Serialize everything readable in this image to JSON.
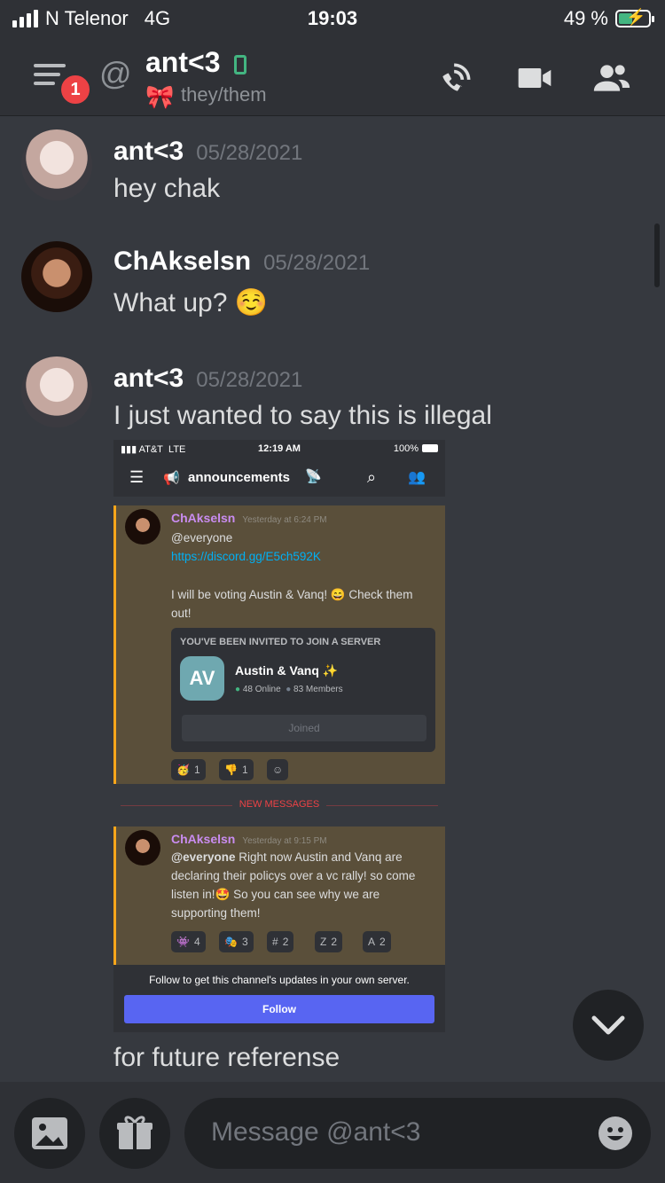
{
  "status_bar": {
    "carrier": "N Telenor",
    "network": "4G",
    "time": "19:03",
    "battery_pct": "49 %"
  },
  "header": {
    "badge_count": "1",
    "at_symbol": "@",
    "name": "ant<3",
    "pronouns": "they/them"
  },
  "messages": [
    {
      "author": "ant<3",
      "timestamp": "05/28/2021",
      "text": "hey chak"
    },
    {
      "author": "ChAkselsn",
      "timestamp": "05/28/2021",
      "text": "What up? ☺️"
    },
    {
      "author": "ant<3",
      "timestamp": "05/28/2021",
      "text": "I just wanted to say this is illegal"
    }
  ],
  "attachment": {
    "status_bar": {
      "carrier": "AT&T",
      "network": "LTE",
      "time": "12:19 AM",
      "battery": "100%"
    },
    "channel": "announcements",
    "post1": {
      "author": "ChAkselsn",
      "timestamp": "Yesterday at 6:24 PM",
      "mention": "@everyone",
      "link": "https://discord.gg/E5ch592K",
      "text": "I will be voting Austin & Vanq! 😄 Check them out!",
      "invite": {
        "heading": "YOU'VE BEEN INVITED TO JOIN A SERVER",
        "server": "Austin & Vanq ✨",
        "online": "48 Online",
        "members": "83 Members",
        "button": "Joined"
      },
      "reactions": [
        "1",
        "1"
      ]
    },
    "divider": "NEW MESSAGES",
    "post2": {
      "author": "ChAkselsn",
      "timestamp": "Yesterday at 9:15 PM",
      "mention": "@everyone",
      "text": "Right now Austin and Vanq are declaring their policys over a vc rally! so come listen in!🤩 So you can see why we are supporting them!",
      "reactions": [
        "4",
        "3",
        "2",
        "2",
        "2"
      ]
    },
    "follow_note": "Follow to get this channel's updates in your own server.",
    "follow_button": "Follow"
  },
  "last_message": "for future referense",
  "composer": {
    "placeholder": "Message @ant<3"
  },
  "colors": {
    "bg": "#36393f",
    "header": "#2f3136",
    "blurple": "#5865f2",
    "online": "#43b581",
    "mention_red": "#ed4245"
  }
}
